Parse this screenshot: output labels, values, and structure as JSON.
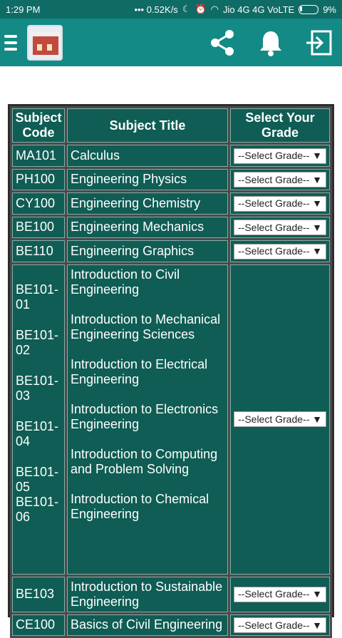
{
  "status": {
    "time": "1:29 PM",
    "speed": "••• 0.52K/s",
    "network": "Jio 4G 4G VoLTE",
    "battery": "9%"
  },
  "appbar": {
    "icons": [
      "menu-icon",
      "share-icon",
      "bell-icon",
      "logout-icon"
    ]
  },
  "table": {
    "headers": [
      "Subject Code",
      "Subject Title",
      "Select Your Grade"
    ],
    "select_label": "--Select Grade--",
    "rows": [
      {
        "code": "MA101",
        "title": "Calculus"
      },
      {
        "code": "PH100",
        "title": "Engineering Physics"
      },
      {
        "code": "CY100",
        "title": "Engineering Chemistry"
      },
      {
        "code": "BE100",
        "title": "Engineering Mechanics"
      },
      {
        "code": "BE110",
        "title": "Engineering Graphics"
      }
    ],
    "group": [
      {
        "code": "BE101-01",
        "title": "Introduction to Civil Engineering"
      },
      {
        "code": "BE101-02",
        "title": "Introduction to Mechanical Engineering Sciences"
      },
      {
        "code": "BE101-03",
        "title": "Introduction to Electrical Engineering"
      },
      {
        "code": "BE101-04",
        "title": "Introduction to Electronics Engineering"
      },
      {
        "code": "BE101-05",
        "title": "Introduction to Computing and Problem Solving"
      },
      {
        "code": "BE101-06",
        "title": "Introduction to Chemical Engineering"
      }
    ],
    "after": [
      {
        "code": "BE103",
        "title": "Introduction to Sustainable Engineering"
      },
      {
        "code": "CE100",
        "title": "Basics of Civil Engineering"
      }
    ]
  },
  "colors": {
    "status_bar": "#0f6b66",
    "app_bar": "#138a85",
    "cell_bg": "#0f5d54"
  }
}
